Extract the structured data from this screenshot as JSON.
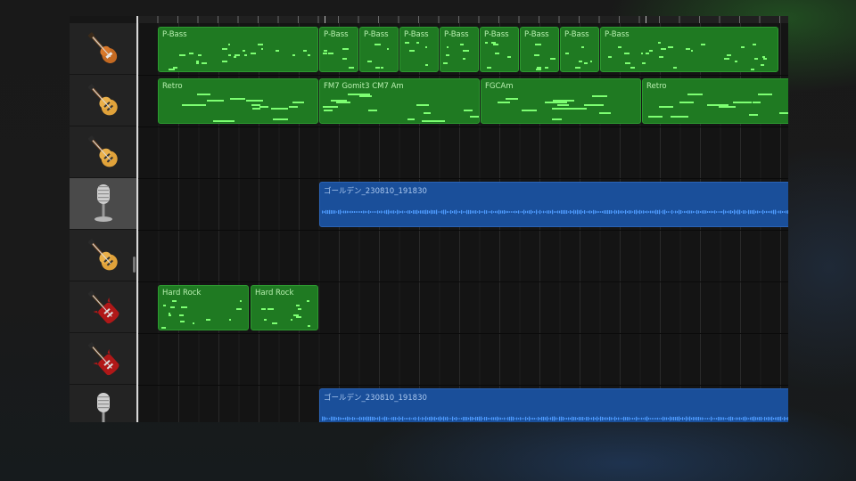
{
  "tracks": [
    {
      "id": "track-1",
      "instrument": "bass-guitar-icon",
      "selected": false
    },
    {
      "id": "track-2",
      "instrument": "electric-guitar-icon",
      "selected": false
    },
    {
      "id": "track-3",
      "instrument": "electric-guitar-icon",
      "selected": false
    },
    {
      "id": "track-4",
      "instrument": "microphone-icon",
      "selected": true
    },
    {
      "id": "track-5",
      "instrument": "electric-guitar-icon",
      "selected": false
    },
    {
      "id": "track-6",
      "instrument": "red-electric-guitar-icon",
      "selected": false
    },
    {
      "id": "track-7",
      "instrument": "red-electric-guitar-icon",
      "selected": false
    },
    {
      "id": "track-8",
      "instrument": "microphone-icon",
      "selected": false
    }
  ],
  "regions": {
    "track1": [
      {
        "name": "P-Bass"
      },
      {
        "name": "P-Bass"
      },
      {
        "name": "P-Bass"
      },
      {
        "name": "P-Bass"
      },
      {
        "name": "P-Bass"
      },
      {
        "name": "P-Bass"
      },
      {
        "name": "P-Bass"
      },
      {
        "name": "P-Bass"
      },
      {
        "name": "P-Bass"
      }
    ],
    "track2": [
      {
        "name": "Retro"
      },
      {
        "name": "FM7 Gomit3 CM7 Am"
      },
      {
        "name": "FGCAm"
      },
      {
        "name": "Retro"
      }
    ],
    "track4": [
      {
        "name": "ゴールデン_230810_191830"
      }
    ],
    "track6": [
      {
        "name": "Hard Rock"
      },
      {
        "name": "Hard Rock"
      }
    ],
    "track8": [
      {
        "name": "ゴールデン_230810_191830"
      }
    ]
  },
  "colors": {
    "midi_region": "#1f7a22",
    "midi_note": "#7dff72",
    "audio_region": "#1a4f9a",
    "audio_wave": "#4f9cff",
    "selected_header": "#4a4a4a"
  }
}
